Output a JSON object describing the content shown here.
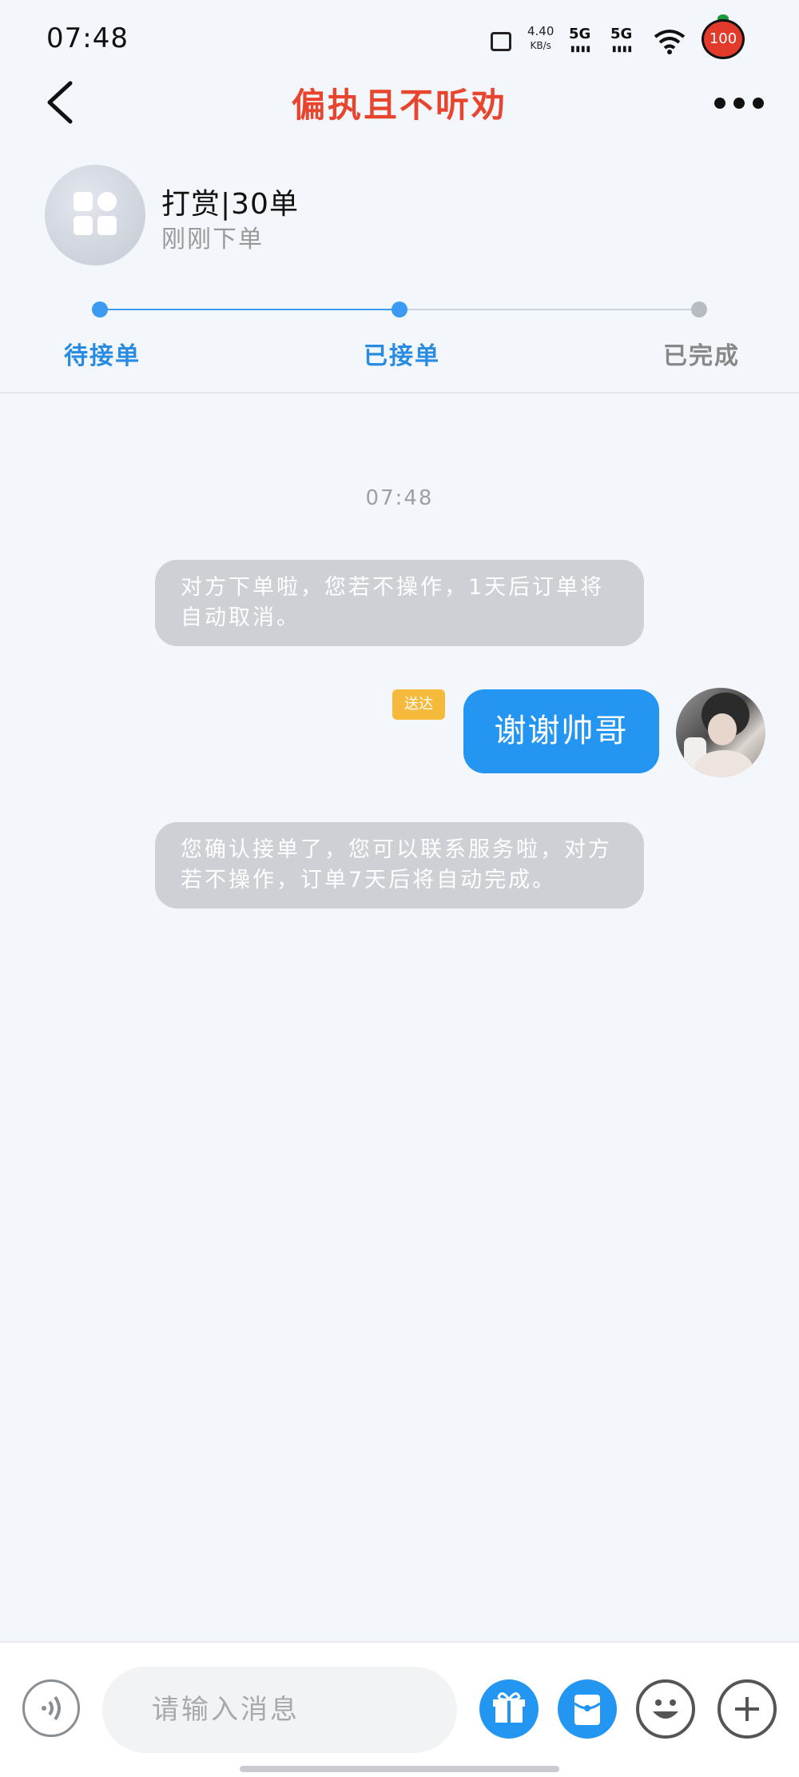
{
  "status_bar": {
    "time": "07:48",
    "net_speed_value": "4.40",
    "net_speed_unit": "KB/s",
    "signal_1": "5G",
    "signal_2": "5G",
    "battery": "100"
  },
  "header": {
    "title": "偏执且不听劝"
  },
  "order": {
    "title": "打赏|30单",
    "subtitle": "刚刚下单"
  },
  "progress": {
    "steps": [
      {
        "label": "待接单",
        "state": "done"
      },
      {
        "label": "已接单",
        "state": "done"
      },
      {
        "label": "已完成",
        "state": "todo"
      }
    ],
    "active_color": "#3b9af2",
    "inactive_color": "#b7bcc3"
  },
  "chat": {
    "timestamp": "07:48",
    "messages": [
      {
        "type": "system",
        "text": "对方下单啦，您若不操作，1天后订单将自动取消。"
      },
      {
        "type": "outgoing",
        "text": "谢谢帅哥",
        "status": "送达"
      },
      {
        "type": "system",
        "text": "您确认接单了，您可以联系服务啦，对方若不操作，订单7天后将自动完成。"
      }
    ]
  },
  "input": {
    "placeholder": "请输入消息",
    "value": ""
  },
  "icons": {
    "back": "chevron-left-icon",
    "more": "more-dots-icon",
    "voice": "voice-icon",
    "gift": "gift-icon",
    "red_packet": "red-packet-icon",
    "emoji": "emoji-icon",
    "plus": "plus-icon"
  }
}
